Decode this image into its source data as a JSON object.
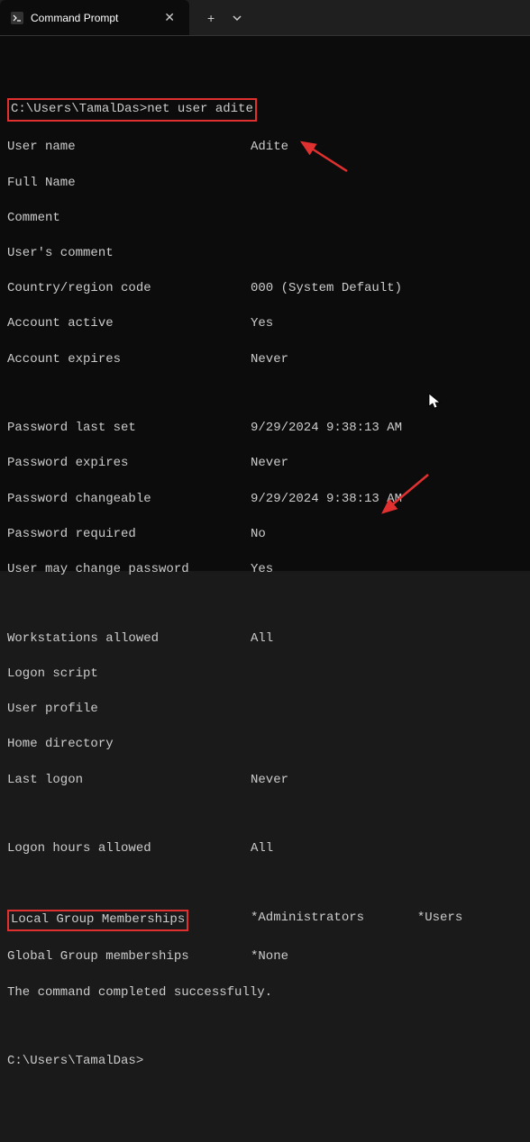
{
  "titlebar": {
    "tab_title": "Command Prompt"
  },
  "cmd": {
    "prompt_path": "C:\\Users\\TamalDas>",
    "command": "net user adite"
  },
  "output": {
    "user_name_label": "User name",
    "user_name_value": "Adite",
    "full_name_label": "Full Name",
    "full_name_value": "",
    "comment_label": "Comment",
    "comment_value": "",
    "users_comment_label": "User's comment",
    "users_comment_value": "",
    "country_label": "Country/region code",
    "country_value": "000 (System Default)",
    "account_active_label": "Account active",
    "account_active_value": "Yes",
    "account_expires_label": "Account expires",
    "account_expires_value": "Never",
    "pw_last_set_label": "Password last set",
    "pw_last_set_value": "9/29/2024 9:38:13 AM",
    "pw_expires_label": "Password expires",
    "pw_expires_value": "Never",
    "pw_changeable_label": "Password changeable",
    "pw_changeable_value": "9/29/2024 9:38:13 AM",
    "pw_required_label": "Password required",
    "pw_required_value": "No",
    "user_may_change_label": "User may change password",
    "user_may_change_value": "Yes",
    "workstations_label": "Workstations allowed",
    "workstations_value": "All",
    "logon_script_label": "Logon script",
    "logon_script_value": "",
    "user_profile_label": "User profile",
    "user_profile_value": "",
    "home_dir_label": "Home directory",
    "home_dir_value": "",
    "last_logon_label": "Last logon",
    "last_logon_value": "Never",
    "logon_hours_label": "Logon hours allowed",
    "logon_hours_value": "All",
    "local_group_label": "Local Group Memberships",
    "local_group_value": "*Administrators       *Users",
    "global_group_label": "Global Group memberships",
    "global_group_value": "*None",
    "completed": "The command completed successfully."
  },
  "prompt2": "C:\\Users\\TamalDas>",
  "annotations": {
    "arrow_color": "#e03030"
  }
}
